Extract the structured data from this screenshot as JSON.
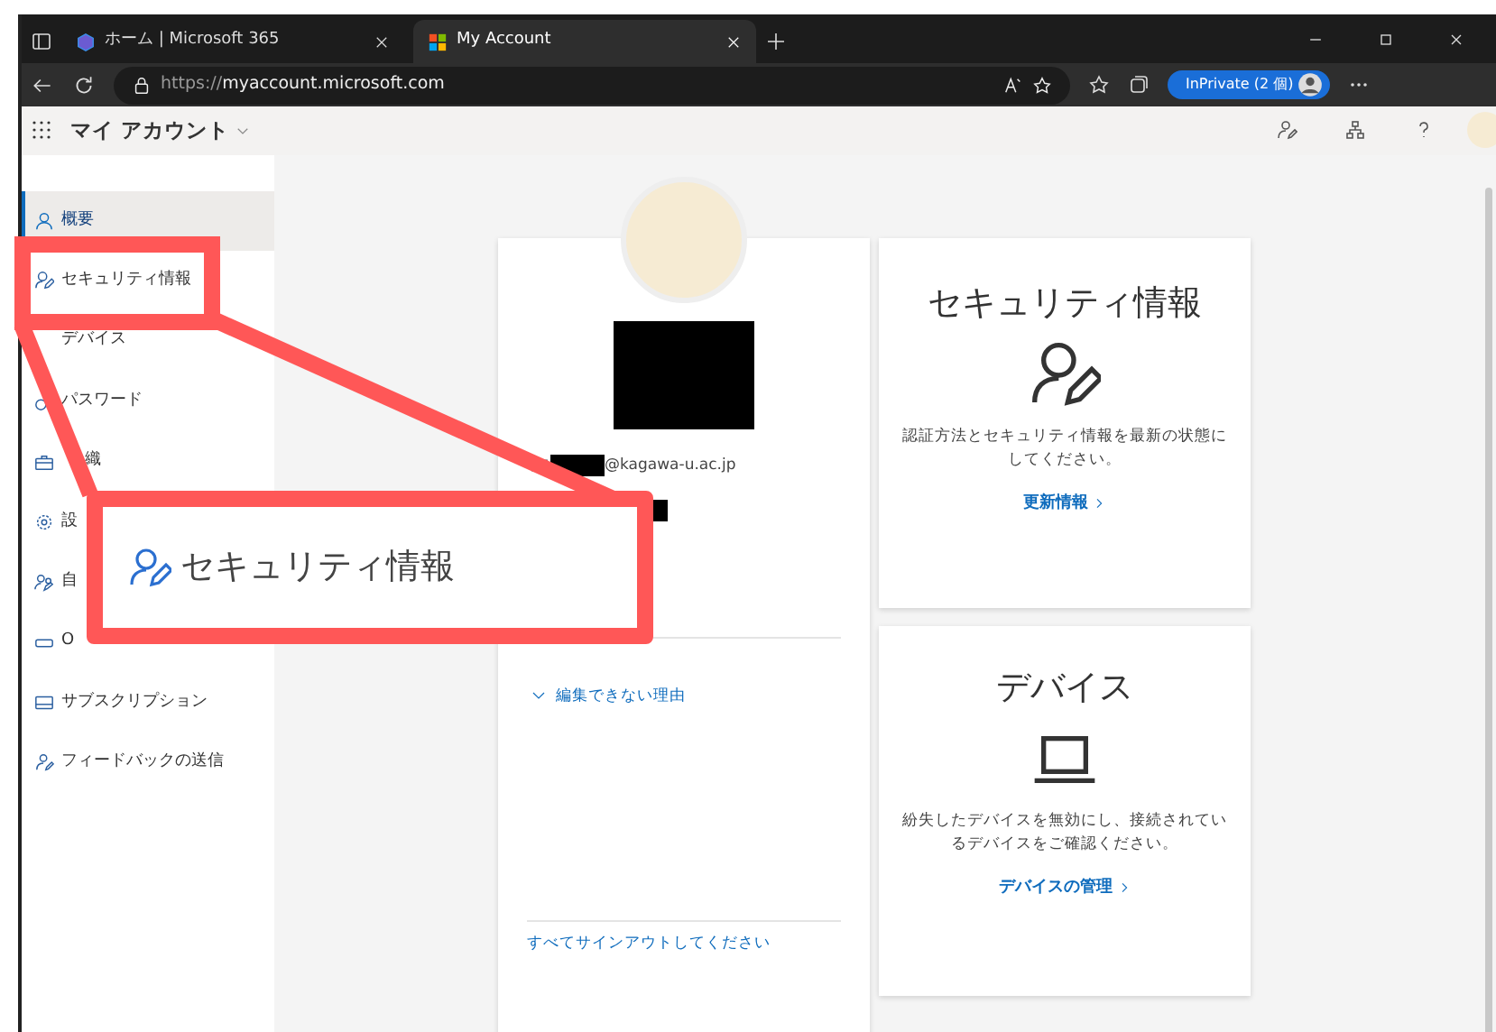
{
  "browser": {
    "tabs": [
      {
        "title": "ホーム | Microsoft 365",
        "kind": "m365",
        "selected": false
      },
      {
        "title": "My Account",
        "kind": "ms",
        "selected": true
      }
    ],
    "url_scheme": "https://",
    "url_host": "myaccount.microsoft.com",
    "profile_label": "InPrivate (2 個)"
  },
  "app": {
    "title": "マイ アカウント"
  },
  "sidebar": {
    "items": [
      {
        "label": "概要",
        "kind": "person",
        "selected": true
      },
      {
        "label": "セキュリティ情報",
        "kind": "person-pen",
        "selected": false
      },
      {
        "label": "デバイス",
        "kind": "none",
        "selected": false
      },
      {
        "label": "パスワード",
        "kind": "key",
        "selected": false
      },
      {
        "label": "織",
        "kind": "briefcase",
        "selected": false,
        "partly_covered": true
      },
      {
        "label": "設",
        "kind": "gear",
        "selected": false
      },
      {
        "label": "自",
        "kind": "people",
        "selected": false
      },
      {
        "label": "O",
        "kind": "apps",
        "selected": false
      },
      {
        "label": "サブスクリプション",
        "kind": "card",
        "selected": false
      },
      {
        "label": "フィードバックの送信",
        "kind": "feedback",
        "selected": false
      }
    ]
  },
  "profile_card": {
    "email": "@kagawa-u.ac.jp",
    "expander": "編集できない理由",
    "sign_out": "すべてサインアウトしてください"
  },
  "cards": [
    {
      "title": "セキュリティ情報",
      "kind": "person-pen",
      "description": "認証方法とセキュリティ情報を最新の状態にしてください。",
      "link": "更新情報"
    },
    {
      "title": "デバイス",
      "kind": "laptop",
      "description": "紛失したデバイスを無効にし、接続されているデバイスをご確認ください。",
      "link": "デバイスの管理"
    }
  ],
  "annotation": {
    "callout_label": "セキュリティ情報"
  }
}
